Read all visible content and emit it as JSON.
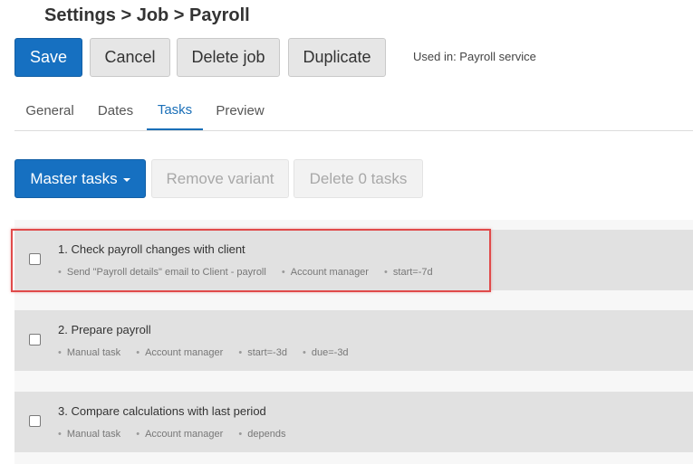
{
  "header": {
    "breadcrumb": "Settings > Job > Payroll"
  },
  "toolbar": {
    "save_label": "Save",
    "cancel_label": "Cancel",
    "delete_job_label": "Delete job",
    "duplicate_label": "Duplicate",
    "used_in": "Used in: Payroll service"
  },
  "tabs": [
    {
      "label": "General",
      "active": false
    },
    {
      "label": "Dates",
      "active": false
    },
    {
      "label": "Tasks",
      "active": true
    },
    {
      "label": "Preview",
      "active": false
    }
  ],
  "actions": {
    "master_tasks_label": "Master tasks",
    "remove_variant_label": "Remove variant",
    "delete_tasks_label": "Delete 0 tasks"
  },
  "tasks": [
    {
      "title": "1. Check payroll changes with client",
      "meta": [
        "Send \"Payroll details\" email to Client - payroll",
        "Account manager",
        "start=-7d"
      ],
      "highlighted": true
    },
    {
      "title": "2. Prepare payroll",
      "meta": [
        "Manual task",
        "Account manager",
        "start=-3d",
        "due=-3d"
      ],
      "highlighted": false
    },
    {
      "title": "3. Compare calculations with last period",
      "meta": [
        "Manual task",
        "Account manager",
        "depends"
      ],
      "highlighted": false
    }
  ],
  "colors": {
    "primary": "#1670c1",
    "active_tab": "#1a6fb8",
    "highlight": "#e04a4a",
    "task_bg": "#e1e1e1"
  }
}
